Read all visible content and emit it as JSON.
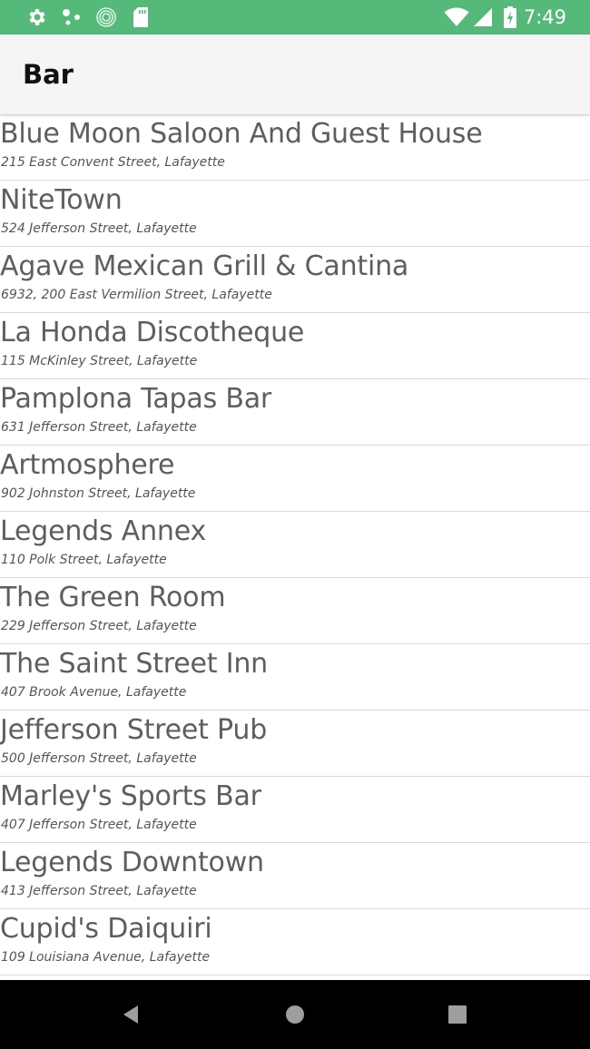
{
  "status_bar": {
    "time": "7:49",
    "left_icons": [
      "settings-icon",
      "share-icon",
      "sync-icon",
      "sd-card-icon"
    ],
    "right_icons": [
      "wifi-icon",
      "cell-signal-icon",
      "battery-icon"
    ],
    "color": "#55b97a"
  },
  "app_bar": {
    "title": "Bar"
  },
  "list": {
    "items": [
      {
        "name": "Blue Moon Saloon And Guest House",
        "address": "215 East Convent Street, Lafayette"
      },
      {
        "name": "NiteTown",
        "address": "524 Jefferson Street, Lafayette"
      },
      {
        "name": "Agave Mexican Grill & Cantina",
        "address": "6932, 200 East Vermilion Street, Lafayette"
      },
      {
        "name": "La Honda Discotheque",
        "address": "115 McKinley Street, Lafayette"
      },
      {
        "name": "Pamplona Tapas Bar",
        "address": "631 Jefferson Street, Lafayette"
      },
      {
        "name": "Artmosphere",
        "address": "902 Johnston Street, Lafayette"
      },
      {
        "name": "Legends Annex",
        "address": "110 Polk Street, Lafayette"
      },
      {
        "name": "The Green Room",
        "address": "229 Jefferson Street, Lafayette"
      },
      {
        "name": "The Saint Street Inn",
        "address": "407 Brook Avenue, Lafayette"
      },
      {
        "name": "Jefferson Street Pub",
        "address": "500 Jefferson Street, Lafayette"
      },
      {
        "name": "Marley's Sports Bar",
        "address": "407 Jefferson Street, Lafayette"
      },
      {
        "name": "Legends Downtown",
        "address": "413 Jefferson Street, Lafayette"
      },
      {
        "name": "Cupid's Daiquiri",
        "address": "109 Louisiana Avenue, Lafayette"
      }
    ]
  },
  "nav_bar": {
    "buttons": [
      "back-icon",
      "home-icon",
      "recents-icon"
    ]
  }
}
